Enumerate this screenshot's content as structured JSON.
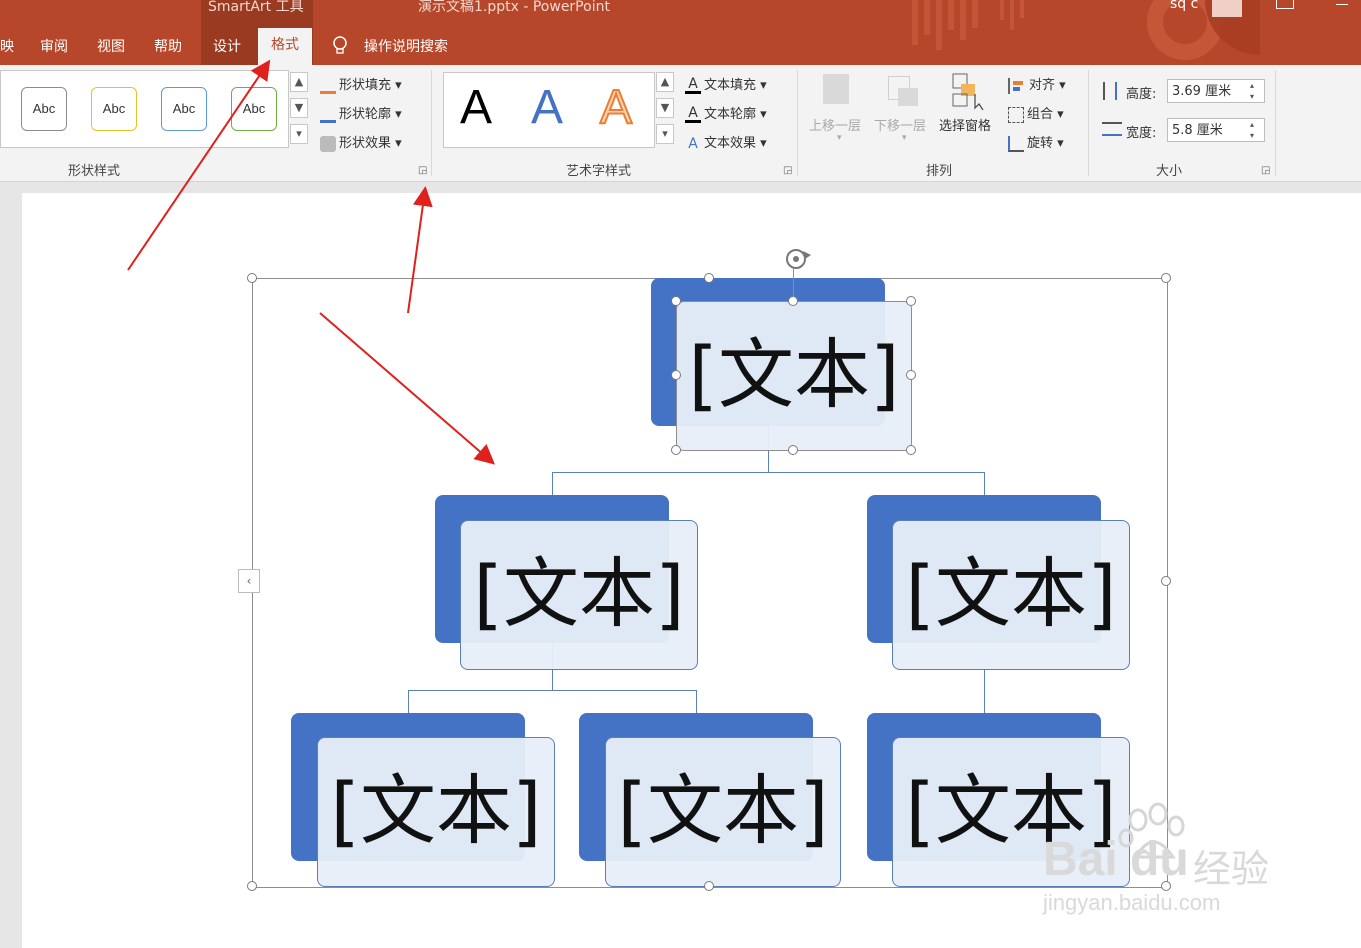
{
  "titlebar": {
    "context_tool": "SmartArt 工具",
    "document_title": "演示文稿1.pptx  -  PowerPoint",
    "user": "sq c"
  },
  "tabs": [
    "映",
    "审阅",
    "视图",
    "帮助",
    "设计",
    "格式"
  ],
  "active_tab": "格式",
  "tell_me": "操作说明搜索",
  "ribbon": {
    "shape_styles": {
      "gallery": [
        "Abc",
        "Abc",
        "Abc",
        "Abc"
      ],
      "fill": "形状填充",
      "outline": "形状轮廓",
      "effects": "形状效果",
      "label": "形状样式"
    },
    "wordart": {
      "gallery": [
        "A",
        "A",
        "A"
      ],
      "fill": "文本填充",
      "outline": "文本轮廓",
      "effects": "文本效果",
      "label": "艺术字样式"
    },
    "arrange": {
      "bring_forward": "上移一层",
      "send_backward": "下移一层",
      "selection_pane": "选择窗格",
      "align": "对齐",
      "group": "组合",
      "rotate": "旋转",
      "label": "排列"
    },
    "size": {
      "height_label": "高度:",
      "height_value": "3.69 厘米",
      "width_label": "宽度:",
      "width_value": "5.8 厘米",
      "label": "大小"
    }
  },
  "smartart": {
    "placeholder": "[文本]"
  },
  "watermark": {
    "brand": "Bai",
    "brand2": "du",
    "cn": "经验",
    "url": "jingyan.baidu.com"
  },
  "colors": {
    "title_bar": "#b7472a",
    "node_blue": "#4472c4",
    "arrow_red": "#e0201c"
  }
}
